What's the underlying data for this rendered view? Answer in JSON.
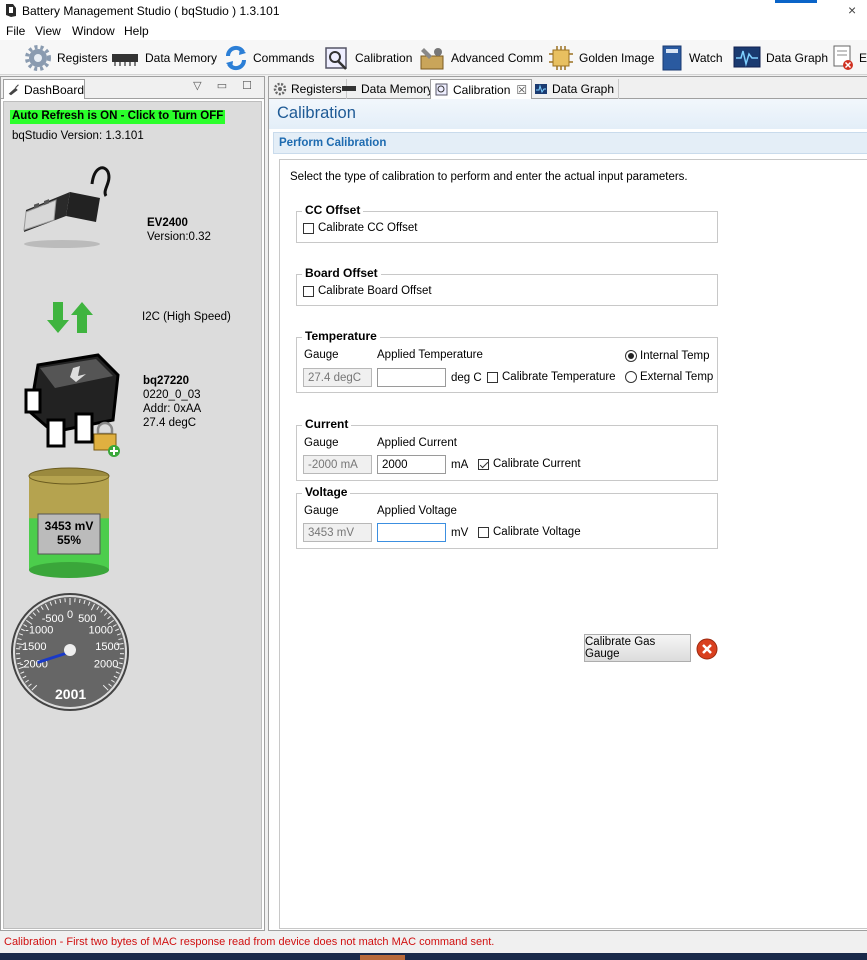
{
  "window": {
    "title": "Battery Management Studio ( bqStudio ) 1.3.101"
  },
  "menu": [
    "File",
    "View",
    "Window",
    "Help"
  ],
  "toolbar": [
    {
      "label": "Registers",
      "icon": "gear-icon"
    },
    {
      "label": "Data Memory",
      "icon": "memory-chip-icon"
    },
    {
      "label": "Commands",
      "icon": "refresh-arrows-icon"
    },
    {
      "label": "Calibration",
      "icon": "calibration-icon"
    },
    {
      "label": "Advanced Comm",
      "icon": "wrench-box-icon"
    },
    {
      "label": "Golden Image",
      "icon": "chip-icon"
    },
    {
      "label": "Watch",
      "icon": "watch-book-icon"
    },
    {
      "label": "Data Graph",
      "icon": "graph-monitor-icon"
    },
    {
      "label": "E",
      "icon": "error-doc-icon"
    }
  ],
  "dashboard": {
    "tab": "DashBoard",
    "refresh": "Auto Refresh is ON - Click to Turn OFF",
    "version": "bqStudio Version:  1.3.101",
    "adapter": {
      "name": "EV2400",
      "version": "Version:0.32"
    },
    "bus": "I2C (High Speed)",
    "device": {
      "name": "bq27220",
      "fw": "0220_0_03",
      "addr": "Addr: 0xAA",
      "temp": "27.4 degC"
    },
    "battery": {
      "voltage": "3453 mV",
      "soc": "55%",
      "soc_value": 55
    },
    "gauge": {
      "value": "2001",
      "ticks": [
        "0",
        "-500",
        "500",
        "-1000",
        "1000",
        "-1500",
        "1500",
        "-2000",
        "2000"
      ],
      "needle_value": -2000
    }
  },
  "tabs": [
    {
      "label": "Registers",
      "icon": "gear-icon"
    },
    {
      "label": "Data Memory",
      "icon": "memory-chip-icon"
    },
    {
      "label": "Calibration",
      "icon": "calibration-icon",
      "close": "☒"
    },
    {
      "label": "Data Graph",
      "icon": "graph-monitor-icon"
    }
  ],
  "calibration": {
    "heading": "Calibration",
    "section": "Perform Calibration",
    "instructions": "Select the type of calibration to perform and enter the actual input parameters.",
    "cc_offset": {
      "title": "CC Offset",
      "check": "Calibrate CC Offset",
      "checked": false
    },
    "board_offset": {
      "title": "Board Offset",
      "check": "Calibrate Board Offset",
      "checked": false
    },
    "temperature": {
      "title": "Temperature",
      "gauge_label": "Gauge",
      "applied_label": "Applied Temperature",
      "gauge_value": "27.4 degC",
      "applied_value": "",
      "unit": "deg C",
      "check": "Calibrate Temperature",
      "checked": false,
      "radio_internal": "Internal Temp",
      "radio_external": "External Temp",
      "selected": "internal"
    },
    "current": {
      "title": "Current",
      "gauge_label": "Gauge",
      "applied_label": "Applied Current",
      "gauge_value": "-2000 mA",
      "applied_value": "2000",
      "unit": "mA",
      "check": "Calibrate Current",
      "checked": true
    },
    "voltage": {
      "title": "Voltage",
      "gauge_label": "Gauge",
      "applied_label": "Applied Voltage",
      "gauge_value": "3453 mV",
      "applied_value": "",
      "unit": "mV",
      "check": "Calibrate Voltage",
      "checked": false
    },
    "button": "Calibrate Gas Gauge"
  },
  "status": "Calibration - First two bytes of MAC response read from device does not match MAC command sent.",
  "colors": {
    "accent": "#1e5a95",
    "refresh_bg": "#2bff2b",
    "error": "#d01010",
    "cancel": "#d9401f"
  }
}
